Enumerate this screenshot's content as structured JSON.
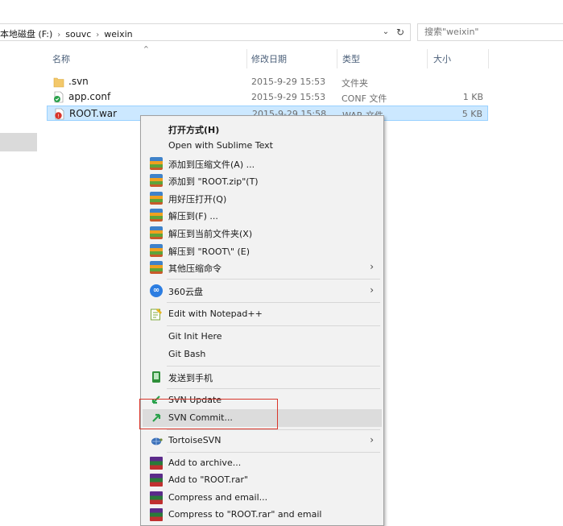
{
  "address": {
    "crumbs": [
      "本地磁盘 (F:)",
      "souvc",
      "weixin"
    ],
    "separator": "›",
    "dropdown_glyph": "⌄",
    "refresh_glyph": "↻"
  },
  "search": {
    "placeholder": "搜索\"weixin\""
  },
  "columns": {
    "name": "名称",
    "date": "修改日期",
    "type": "类型",
    "size": "大小",
    "sort_glyph": "^"
  },
  "files": [
    {
      "name": ".svn",
      "date": "2015-9-29 15:53",
      "type": "文件夹",
      "size": "",
      "icon": "folder-icon"
    },
    {
      "name": "app.conf",
      "date": "2015-9-29 15:53",
      "type": "CONF 文件",
      "size": "1 KB",
      "icon": "svn-file-icon"
    },
    {
      "name": "ROOT.war",
      "date": "2015-9-29 15:58",
      "type": "WAR 文件",
      "size": "5 KB",
      "icon": "war-file-icon",
      "selected": true
    }
  ],
  "menu": {
    "items": [
      {
        "label": "打开方式(H)",
        "bold": true
      },
      {
        "label": "Open with Sublime Text"
      },
      {
        "label": "添加到压缩文件(A) ...",
        "icon": "winrar-icon"
      },
      {
        "label": "添加到 \"ROOT.zip\"(T)",
        "icon": "winrar-icon"
      },
      {
        "label": "用好压打开(Q)",
        "icon": "winrar-icon"
      },
      {
        "label": "解压到(F) ...",
        "icon": "winrar-icon"
      },
      {
        "label": "解压到当前文件夹(X)",
        "icon": "winrar-icon"
      },
      {
        "label": "解压到 \"ROOT\\\" (E)",
        "icon": "winrar-icon"
      },
      {
        "label": "其他压缩命令",
        "icon": "winrar-icon",
        "submenu": true
      },
      {
        "label": "360云盘",
        "icon": "cloud-360-icon",
        "submenu": true
      },
      {
        "label": "Edit with Notepad++",
        "icon": "notepad-plus-icon"
      },
      {
        "label": "Git Init Here"
      },
      {
        "label": "Git Bash"
      },
      {
        "label": "发送到手机",
        "icon": "phone-icon"
      },
      {
        "label": "SVN Update",
        "icon": "svn-update-icon"
      },
      {
        "label": "SVN Commit...",
        "icon": "svn-commit-icon",
        "highlighted": true
      },
      {
        "label": "TortoiseSVN",
        "icon": "tortoisesvn-icon",
        "submenu": true
      },
      {
        "label": "Add to archive...",
        "icon": "rar-books-icon"
      },
      {
        "label": "Add to \"ROOT.rar\"",
        "icon": "rar-books-icon"
      },
      {
        "label": "Compress and email...",
        "icon": "rar-books-icon"
      },
      {
        "label": "Compress to \"ROOT.rar\" and email",
        "icon": "rar-books-icon"
      }
    ],
    "submenu_glyph": "›"
  },
  "colors": {
    "selection": "#cce8ff",
    "selection_border": "#99d1ff",
    "annotation": "#d9352a",
    "menu_bg": "#f2f2f2"
  }
}
